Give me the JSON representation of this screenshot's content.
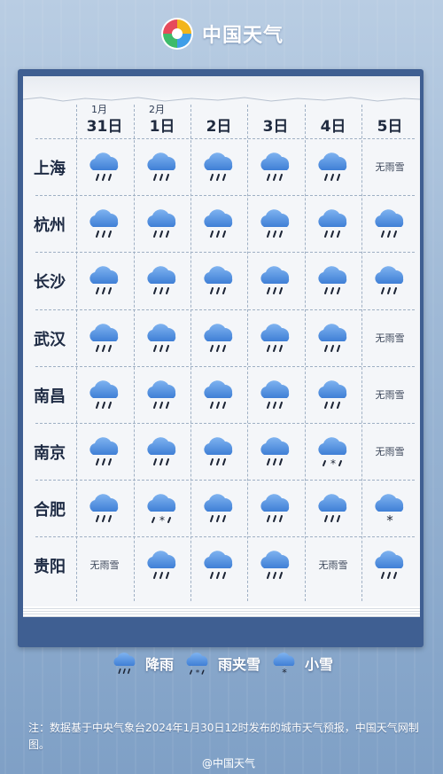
{
  "header": {
    "brand": "中国天气"
  },
  "columns": [
    {
      "month": "1月",
      "day": "31日"
    },
    {
      "month": "2月",
      "day": "1日"
    },
    {
      "month": "",
      "day": "2日"
    },
    {
      "month": "",
      "day": "3日"
    },
    {
      "month": "",
      "day": "4日"
    },
    {
      "month": "",
      "day": "5日"
    }
  ],
  "rows": [
    {
      "city": "上海",
      "cells": [
        "rain",
        "rain",
        "rain",
        "rain",
        "rain",
        "none"
      ]
    },
    {
      "city": "杭州",
      "cells": [
        "rain",
        "rain",
        "rain",
        "rain",
        "rain",
        "rain"
      ]
    },
    {
      "city": "长沙",
      "cells": [
        "rain",
        "rain",
        "rain",
        "rain",
        "rain",
        "rain"
      ]
    },
    {
      "city": "武汉",
      "cells": [
        "rain",
        "rain",
        "rain",
        "rain",
        "rain",
        "none"
      ]
    },
    {
      "city": "南昌",
      "cells": [
        "rain",
        "rain",
        "rain",
        "rain",
        "rain",
        "none"
      ]
    },
    {
      "city": "南京",
      "cells": [
        "rain",
        "rain",
        "rain",
        "rain",
        "sleet",
        "none"
      ]
    },
    {
      "city": "合肥",
      "cells": [
        "rain",
        "sleet",
        "rain",
        "rain",
        "rain",
        "snow"
      ]
    },
    {
      "city": "贵阳",
      "cells": [
        "none",
        "rain",
        "rain",
        "rain",
        "none",
        "rain"
      ]
    }
  ],
  "none_text": "无雨雪",
  "legend": [
    {
      "icon": "rain",
      "label": "降雨"
    },
    {
      "icon": "sleet",
      "label": "雨夹雪"
    },
    {
      "icon": "snow",
      "label": "小雪"
    }
  ],
  "footnote": "注：数据基于中央气象台2024年1月30日12时发布的城市天气预报，中国天气网制图。",
  "credit": "@中国天气",
  "colors": {
    "cloud_top": "#7fb3f0",
    "cloud_bottom": "#3f7fd6",
    "frame": "#3f5f92"
  }
}
